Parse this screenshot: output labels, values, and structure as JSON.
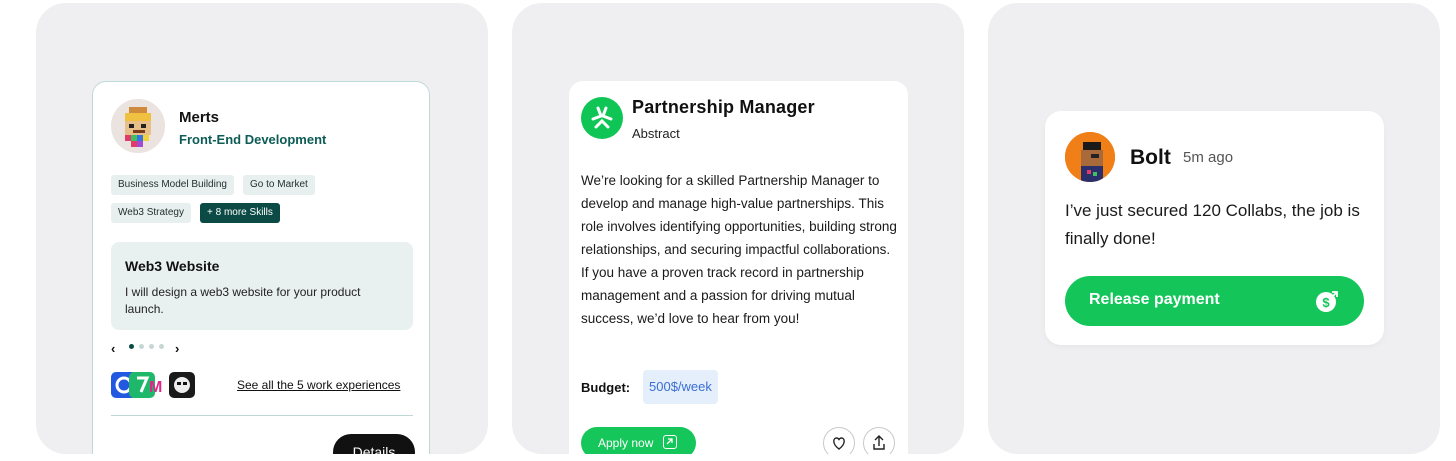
{
  "profile_card": {
    "name": "Merts",
    "role": "Front-End Development",
    "skills": [
      "Business Model Building",
      "Go to Market",
      "Web3 Strategy"
    ],
    "more_skills": "+ 8 more Skills",
    "work": {
      "title": "Web3 Website",
      "description": "I will design a web3 website for your product launch."
    },
    "carousel": {
      "total": 4,
      "active": 1
    },
    "see_all_link": "See all the 5 work experiences",
    "details_button": "Details"
  },
  "job_card": {
    "title": "Partnership Manager",
    "company": "Abstract",
    "description": "We’re looking for a skilled Partnership Manager to develop and manage high-value partnerships. This role involves identifying opportunities, building strong relationships, and securing impactful collaborations. If you have a proven track record in partnership management and a passion for driving mutual success, we’d love to hear from you!",
    "budget_label": "Budget:",
    "budget_value": "500$/week",
    "apply_button": "Apply now"
  },
  "message_card": {
    "sender": "Bolt",
    "time": "5m ago",
    "message": "I’ve just secured 120 Collabs, the job is finally done!",
    "release_button": "Release payment"
  },
  "colors": {
    "accent_green": "#14c65a",
    "dark_teal": "#0b4a45",
    "panel_bg": "#efeff1",
    "budget_blue": "#3a6fd4"
  }
}
